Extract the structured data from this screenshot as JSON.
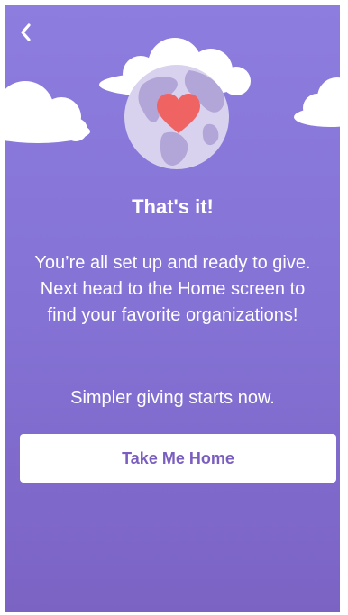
{
  "nav": {
    "back_icon": "chevron-left-icon"
  },
  "illustration": {
    "icons": [
      "globe-icon",
      "heart-icon",
      "cloud-icon"
    ],
    "colors": {
      "globe": "#d9d2ee",
      "land": "#b2a5d8",
      "heart": "#f06363",
      "cloud": "#ffffff"
    }
  },
  "content": {
    "title": "That's it!",
    "message": "You’re all set up and ready to give. Next head to the Home screen to find your favorite organizations!",
    "tagline": "Simpler giving starts now."
  },
  "actions": {
    "primary_label": "Take Me Home"
  },
  "colors": {
    "background_top": "#8d7ddf",
    "background_bottom": "#7b63c4",
    "button_text": "#7b5fc0"
  }
}
